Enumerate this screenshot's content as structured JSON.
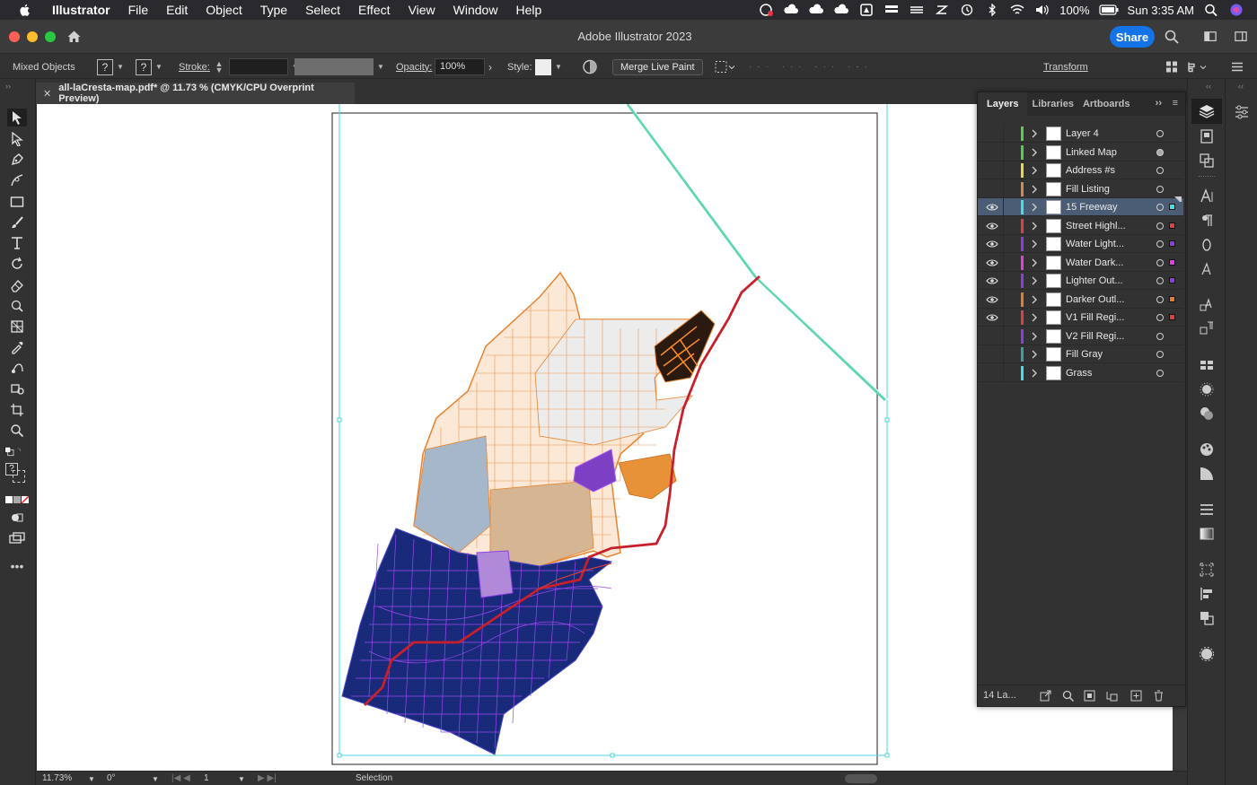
{
  "menubar": {
    "app_name": "Illustrator",
    "items": [
      "File",
      "Edit",
      "Object",
      "Type",
      "Select",
      "Effect",
      "View",
      "Window",
      "Help"
    ],
    "battery": "100%",
    "clock": "Sun 3:35 AM"
  },
  "window": {
    "title": "Adobe Illustrator 2023",
    "share_label": "Share"
  },
  "controlbar": {
    "selection_label": "Mixed Objects",
    "fill_placeholder": "?",
    "stroke_placeholder": "?",
    "stroke_label": "Stroke:",
    "opacity_label": "Opacity:",
    "opacity_value": "100%",
    "style_label": "Style:",
    "merge_live_paint": "Merge Live Paint",
    "transform_label": "Transform"
  },
  "document": {
    "tab_title": "all-laCresta-map.pdf* @ 11.73 % (CMYK/CPU Overprint Preview)"
  },
  "statusbar": {
    "zoom": "11.73%",
    "rotation": "0°",
    "artboard": "1",
    "tool": "Selection"
  },
  "layers_panel": {
    "tabs": [
      "Layers",
      "Libraries",
      "Artboards"
    ],
    "footer_count": "14 La...",
    "layers": [
      {
        "name": "Layer 4",
        "color": "#4fd14a",
        "visible": false,
        "targeted": false,
        "selected": false,
        "sel_color": ""
      },
      {
        "name": "Linked Map",
        "color": "#4fd14a",
        "visible": false,
        "targeted": true,
        "selected": false,
        "sel_color": ""
      },
      {
        "name": "Address #s",
        "color": "#e6d94a",
        "visible": false,
        "targeted": false,
        "selected": false,
        "sel_color": ""
      },
      {
        "name": "Fill Listing",
        "color": "#d08b50",
        "visible": false,
        "targeted": false,
        "selected": false,
        "sel_color": ""
      },
      {
        "name": "15 Freeway",
        "color": "#40e0e8",
        "visible": true,
        "targeted": false,
        "selected": true,
        "sel_color": "#40e0e8"
      },
      {
        "name": "Street Highl...",
        "color": "#e04040",
        "visible": true,
        "targeted": false,
        "selected": false,
        "sel_color": "#e04040"
      },
      {
        "name": "Water Light...",
        "color": "#8a3ee0",
        "visible": true,
        "targeted": false,
        "selected": false,
        "sel_color": "#8a3ee0"
      },
      {
        "name": "Water Dark...",
        "color": "#e040e0",
        "visible": true,
        "targeted": false,
        "selected": false,
        "sel_color": "#e040e0"
      },
      {
        "name": "Lighter Out...",
        "color": "#8a3ee0",
        "visible": true,
        "targeted": false,
        "selected": false,
        "sel_color": "#8a3ee0"
      },
      {
        "name": "Darker Outl...",
        "color": "#e87a30",
        "visible": true,
        "targeted": false,
        "selected": false,
        "sel_color": "#e87a30"
      },
      {
        "name": "V1 Fill Regi...",
        "color": "#e04040",
        "visible": true,
        "targeted": false,
        "selected": false,
        "sel_color": "#e04040"
      },
      {
        "name": "V2 Fill Regi...",
        "color": "#8a3ee0",
        "visible": false,
        "targeted": false,
        "selected": false,
        "sel_color": ""
      },
      {
        "name": "Fill Gray",
        "color": "#3aa0a0",
        "visible": false,
        "targeted": false,
        "selected": false,
        "sel_color": ""
      },
      {
        "name": "Grass",
        "color": "#40e0e8",
        "visible": false,
        "targeted": false,
        "selected": false,
        "sel_color": ""
      }
    ]
  }
}
